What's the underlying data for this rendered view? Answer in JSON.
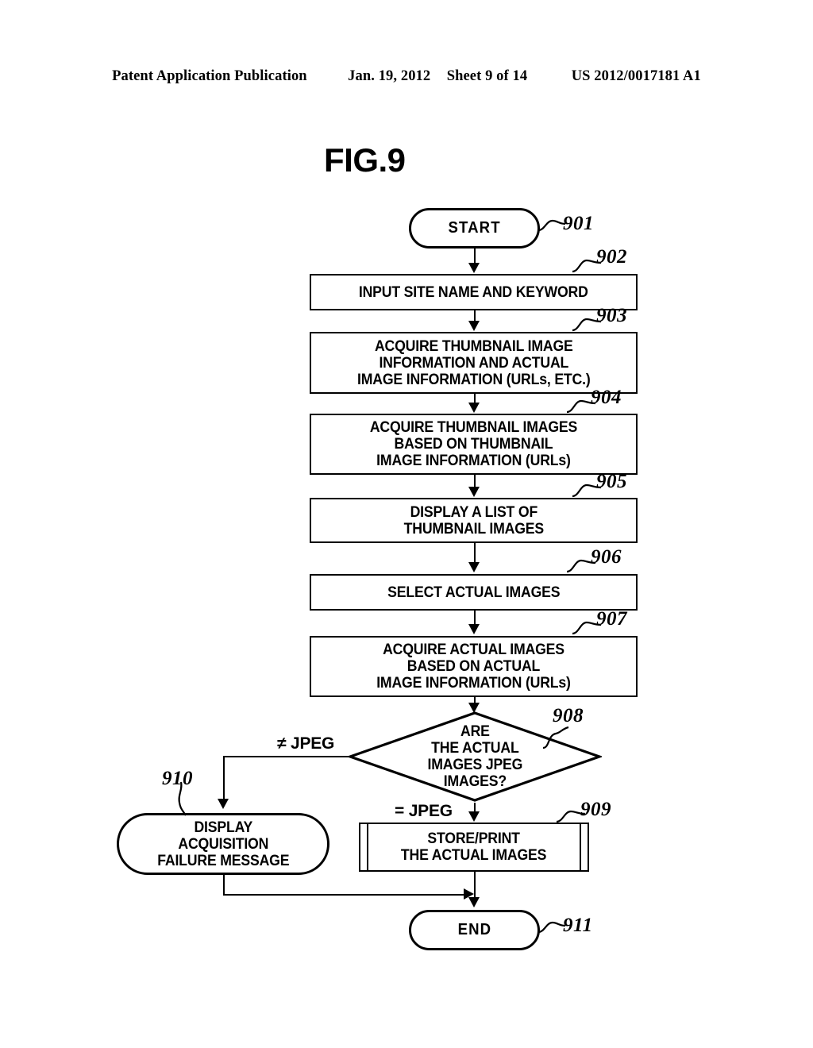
{
  "header": {
    "publication": "Patent Application Publication",
    "date": "Jan. 19, 2012",
    "sheet": "Sheet 9 of 14",
    "docnum": "US 2012/0017181 A1"
  },
  "figure": {
    "title": "FIG.9"
  },
  "flowchart": {
    "nodes": [
      {
        "id": "901",
        "shape": "terminal",
        "text": "START"
      },
      {
        "id": "902",
        "shape": "process",
        "text": "INPUT SITE NAME AND KEYWORD"
      },
      {
        "id": "903",
        "shape": "process",
        "text": "ACQUIRE THUMBNAIL IMAGE\nINFORMATION AND ACTUAL\nIMAGE INFORMATION (URLs, ETC.)"
      },
      {
        "id": "904",
        "shape": "process",
        "text": "ACQUIRE THUMBNAIL IMAGES\nBASED ON THUMBNAIL\nIMAGE INFORMATION (URLs)"
      },
      {
        "id": "905",
        "shape": "process",
        "text": "DISPLAY A LIST OF\nTHUMBNAIL IMAGES"
      },
      {
        "id": "906",
        "shape": "process",
        "text": "SELECT ACTUAL IMAGES"
      },
      {
        "id": "907",
        "shape": "process",
        "text": "ACQUIRE ACTUAL IMAGES\nBASED ON ACTUAL\nIMAGE INFORMATION (URLs)"
      },
      {
        "id": "908",
        "shape": "decision",
        "text": "ARE\nTHE ACTUAL\nIMAGES JPEG\nIMAGES?"
      },
      {
        "id": "909",
        "shape": "subprocess",
        "text": "STORE/PRINT\nTHE ACTUAL IMAGES"
      },
      {
        "id": "910",
        "shape": "terminal",
        "text": "DISPLAY\nACQUISITION\nFAILURE MESSAGE"
      },
      {
        "id": "911",
        "shape": "terminal",
        "text": "END"
      }
    ],
    "branch_labels": {
      "not_jpeg": "≠ JPEG",
      "is_jpeg": "= JPEG"
    }
  },
  "colors": {
    "ink": "#000000",
    "paper": "#ffffff"
  }
}
